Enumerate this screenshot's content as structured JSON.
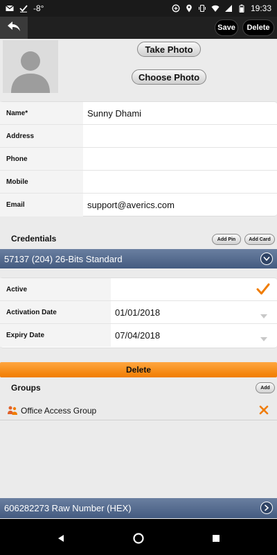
{
  "status_bar": {
    "temperature": "-8°",
    "time": "19:33",
    "left_icons": [
      "gmail-icon",
      "checkmark-icon"
    ],
    "right_icons": [
      "data-saver-icon",
      "location-icon",
      "vibrate-icon",
      "wifi-icon",
      "signal-icon",
      "battery-icon"
    ]
  },
  "toolbar": {
    "save_label": "Save",
    "delete_label": "Delete"
  },
  "photo": {
    "take_photo_label": "Take Photo",
    "choose_photo_label": "Choose Photo"
  },
  "person": {
    "fields": [
      {
        "label": "Name*",
        "value": "Sunny  Dhami"
      },
      {
        "label": "Address",
        "value": ""
      },
      {
        "label": "Phone",
        "value": ""
      },
      {
        "label": "Mobile",
        "value": ""
      },
      {
        "label": "Email",
        "value": "support@averics.com"
      }
    ]
  },
  "credentials": {
    "title": "Credentials",
    "add_pin_label": "Add Pin",
    "add_card_label": "Add Card",
    "selected_credential": "57137 (204) 26-Bits Standard",
    "active_label": "Active",
    "active": true,
    "activation_date_label": "Activation Date",
    "activation_date": "01/01/2018",
    "expiry_date_label": "Expiry Date",
    "expiry_date": "07/04/2018",
    "delete_label": "Delete"
  },
  "groups": {
    "title": "Groups",
    "add_label": "Add",
    "items": [
      {
        "name": "Office Access Group"
      }
    ]
  },
  "footer_credential": "606282273 Raw Number (HEX)",
  "colors": {
    "accent_orange": "#f07c00",
    "bar_blue": "#445b80",
    "toolbar_dark": "#202020"
  }
}
